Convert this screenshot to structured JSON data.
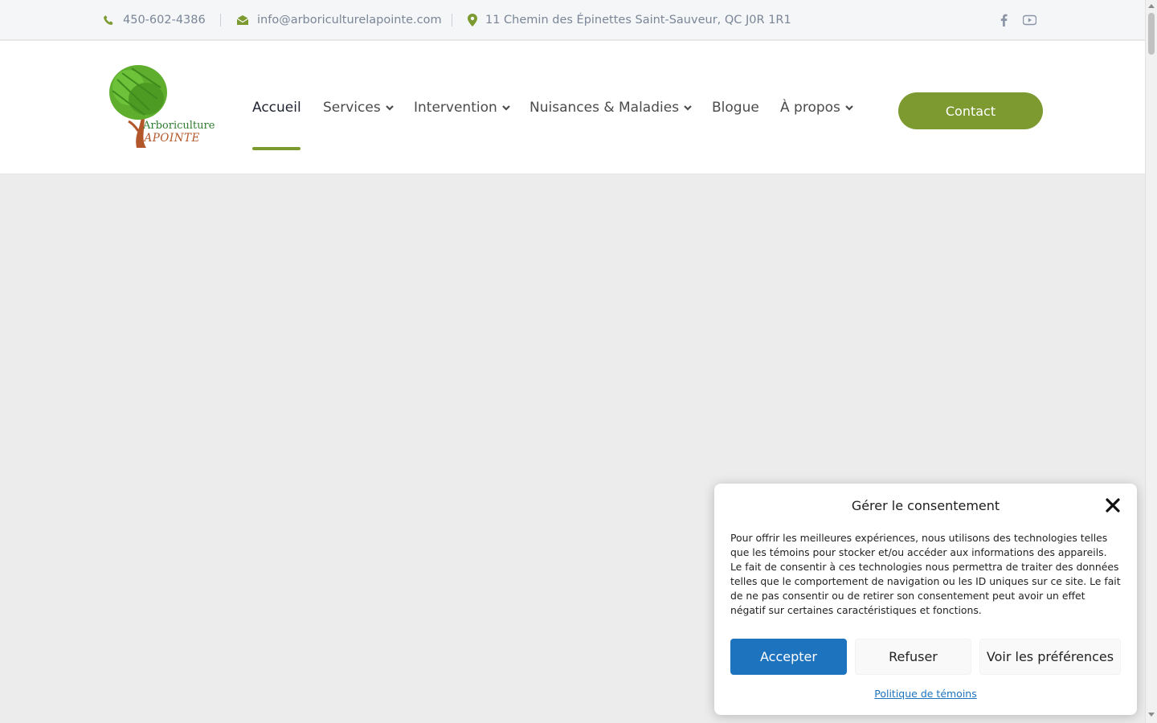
{
  "topbar": {
    "phone": "450-602-4386",
    "email": "info@arboriculturelapointe.com",
    "address": "11 Chemin des Épinettes Saint-Sauveur, QC J0R 1R1",
    "social": [
      "facebook-icon",
      "youtube-icon"
    ]
  },
  "logo": {
    "line1": "Arboriculture",
    "line2": "LAPOINTE"
  },
  "nav": {
    "items": [
      {
        "label": "Accueil",
        "dropdown": false,
        "active": true
      },
      {
        "label": "Services",
        "dropdown": true
      },
      {
        "label": "Intervention",
        "dropdown": true
      },
      {
        "label": "Nuisances & Maladies",
        "dropdown": true
      },
      {
        "label": "Blogue",
        "dropdown": false
      },
      {
        "label": "À propos",
        "dropdown": true
      }
    ],
    "contact_label": "Contact"
  },
  "consent": {
    "title": "Gérer le consentement",
    "body": "Pour offrir les meilleures expériences, nous utilisons des technologies telles que les témoins pour stocker et/ou accéder aux informations des appareils. Le fait de consentir à ces technologies nous permettra de traiter des données telles que le comportement de navigation ou les ID uniques sur ce site. Le fait de ne pas consentir ou de retirer son consentement peut avoir un effet négatif sur certaines caractéristiques et fonctions.",
    "accept_label": "Accepter",
    "refuse_label": "Refuser",
    "prefs_label": "Voir les préférences",
    "policy_label": "Politique de témoins"
  },
  "colors": {
    "brand_green": "#7c9a30",
    "accept_blue": "#1e73be",
    "topbar_text": "#7a8596"
  }
}
